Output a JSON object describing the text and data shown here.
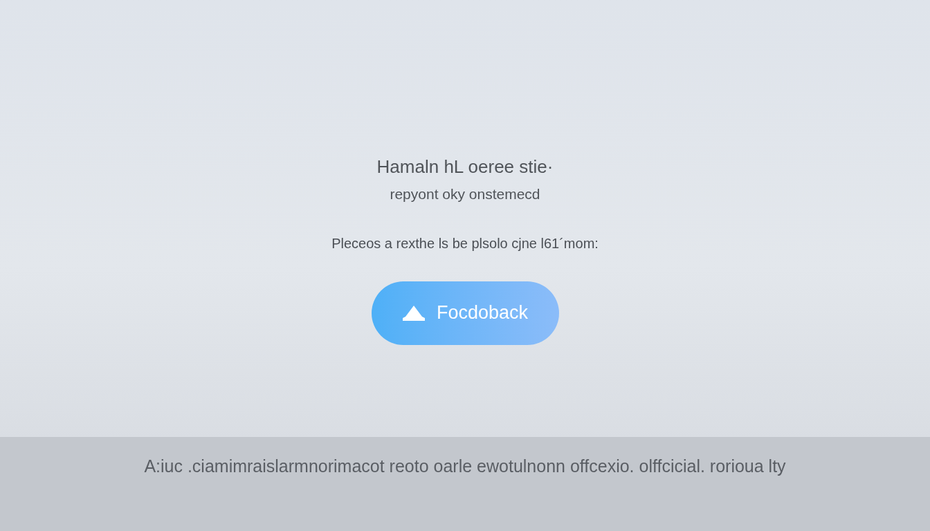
{
  "heading": [
    "Hamaln hL oeree stie·",
    "repyont oky onstemecd"
  ],
  "message": "Pleceos a rexthe ls be plsolo cjne l61´mom:",
  "button": {
    "label": "Focdoback"
  },
  "footer_bar": {
    "text": "A:iuc .ciamimraislarmnorimacot reoto oarle ewotulnonn offcexio. olffcicial. rorioua lty"
  }
}
